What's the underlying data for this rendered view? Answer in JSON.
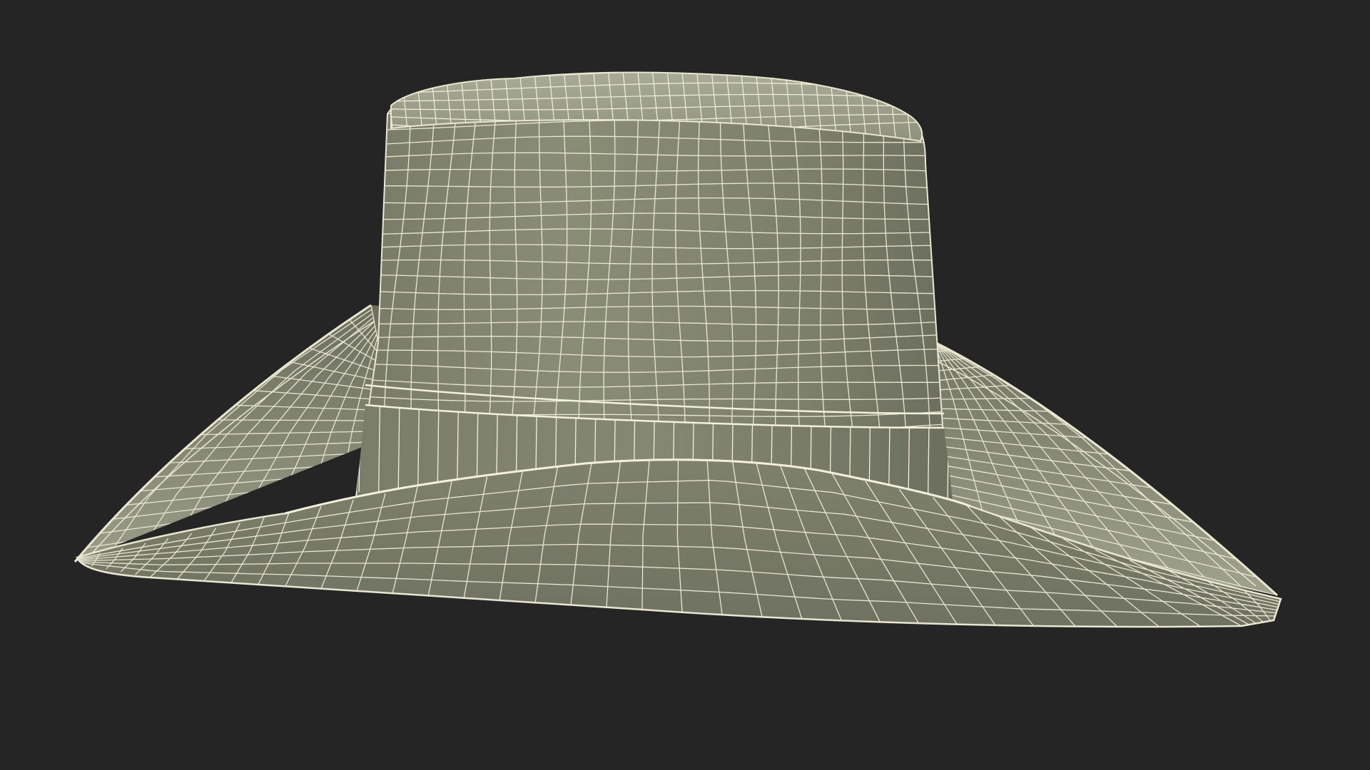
{
  "scene": {
    "subject": "cowboy-hat-wireframe",
    "render_mode": "wireframe",
    "colors": {
      "background": "#252525",
      "surface_light": "#a4a792",
      "surface_mid": "#8d9079",
      "surface_dark": "#6e7160",
      "wire": "#f3f0dc",
      "edge": "#e9e6d2"
    }
  }
}
